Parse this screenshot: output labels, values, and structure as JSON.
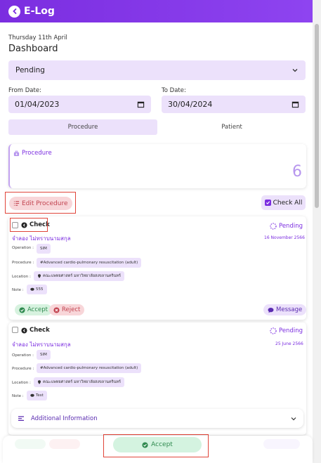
{
  "app": {
    "title": "E-Log"
  },
  "header": {
    "date": "Thursday 11th April",
    "title": "Dashboard"
  },
  "filter": {
    "status_value": "Pending",
    "from_label": "From Date:",
    "from_value": "01/04/2023",
    "to_label": "To Date:",
    "to_value": "30/04/2024"
  },
  "tabs": [
    {
      "label": "Procedure",
      "active": true
    },
    {
      "label": "Patient",
      "active": false
    }
  ],
  "procedure_card": {
    "label": "Procedure",
    "count": "6"
  },
  "actions": {
    "edit_label": "Edit Procedure",
    "check_all_label": "Check All"
  },
  "records": [
    {
      "check_label": "Check",
      "status": "Pending",
      "patient": "จำลอง ไม่ทราบนามสกุล",
      "date": "16 November 2566",
      "operation_label": "Operation :",
      "operation": "SIM",
      "procedure_label": "Procedure :",
      "procedure": "#Advanced cardio-pulmonary resuscitation (adult)",
      "location_label": "Location :",
      "location": "คณะแพทยศาสตร์ มหาวิทยาลัยสงขลานครินทร์",
      "note_label": "Note :",
      "note": "555",
      "accept_label": "Accept",
      "reject_label": "Reject",
      "message_label": "Message"
    },
    {
      "check_label": "Check",
      "status": "Pending",
      "patient": "จำลอง ไม่ทราบนามสกุล",
      "date": "25 June 2566",
      "operation_label": "Operation :",
      "operation": "SIM",
      "procedure_label": "Procedure :",
      "procedure": "#Advanced cardio-pulmonary resuscitation (adult)",
      "location_label": "Location :",
      "location": "คณะแพทยศาสตร์ มหาวิทยาลัยสงขลานครินทร์",
      "note_label": "Note :",
      "note": "Test",
      "additional_label": "Additional Information"
    }
  ],
  "bottom": {
    "accept_label": "Accept"
  },
  "colors": {
    "primary": "#7b2de0",
    "accent_light": "#ece1fb",
    "accept": "#2f8a4f",
    "reject": "#c24450",
    "highlight_box": "#e0453a"
  }
}
